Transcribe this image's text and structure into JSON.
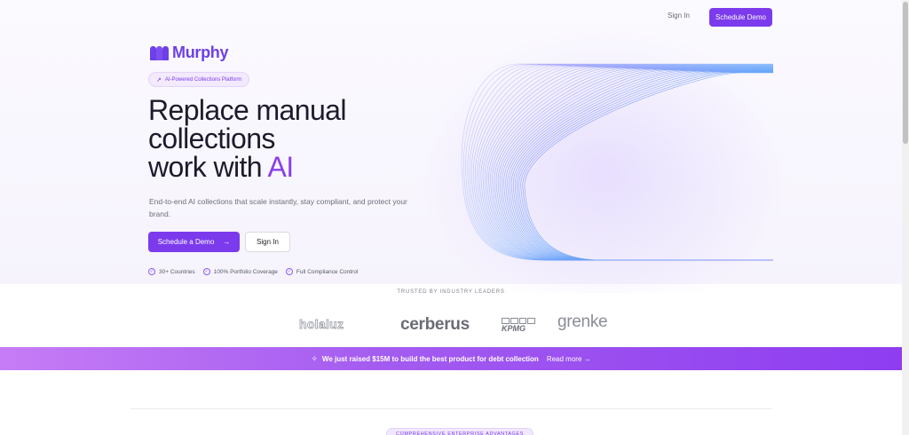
{
  "header": {
    "signin_label": "Sign In",
    "demo_label": "Schedule Demo"
  },
  "logo": {
    "text": "Murphy"
  },
  "hero": {
    "pill_label": "AI-Powered Collections Platform",
    "headline_line1": "Replace manual",
    "headline_line2": "collections",
    "headline_line3_prefix": "work with ",
    "headline_accent": "AI",
    "subtext": "End-to-end AI collections that scale instantly, stay compliant, and protect your brand.",
    "primary_button": "Schedule a Demo",
    "secondary_button": "Sign In",
    "features": [
      "30+ Countries",
      "100% Portfolio Coverage",
      "Full Compliance Control"
    ]
  },
  "trusted": {
    "label": "TRUSTED BY INDUSTRY LEADERS",
    "logos": [
      "holaluz",
      "cerberus",
      "KPMG",
      "grenke"
    ]
  },
  "banner": {
    "text": "We just raised $15M to build the best product for debt collection",
    "link": "Read more →"
  },
  "section": {
    "pill_label": "COMPREHENSIVE ENTERPRISE ADVANTAGES"
  },
  "colors": {
    "accent": "#7c3aed",
    "headline_accent": "#8b3fe8",
    "lines": "#60a5fa"
  },
  "icons": {
    "pill": "trend-up-icon",
    "feature": "check-circle-icon",
    "banner": "sparkles-icon",
    "arrow": "arrow-right-icon"
  }
}
